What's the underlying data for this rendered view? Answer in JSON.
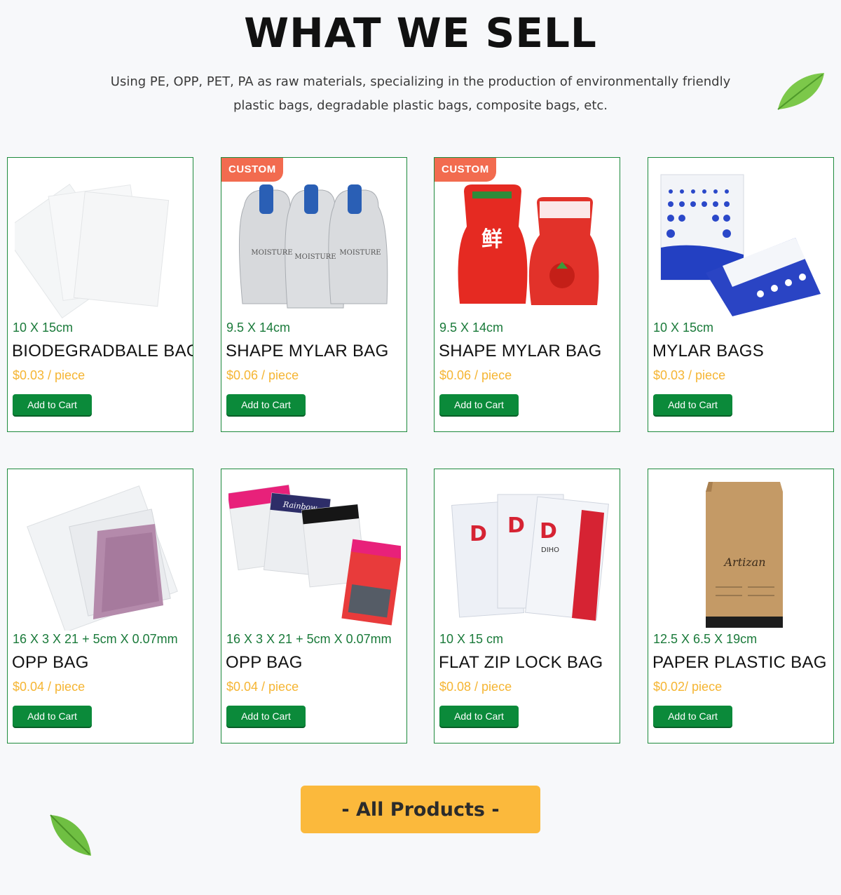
{
  "header": {
    "title": "WHAT WE SELL",
    "subtitle": "Using PE, OPP, PET, PA as raw materials, specializing in the production of environmentally friendly plastic bags, degradable plastic bags, composite bags, etc."
  },
  "products": [
    {
      "badge": "",
      "size": "10 X 15cm",
      "name": "BIODEGRADBALE BAGS",
      "price": "$0.03 / piece",
      "cart_label": "Add to Cart",
      "image": "clear-flat-bags"
    },
    {
      "badge": "CUSTOM",
      "size": "9.5 X 14cm",
      "name": "SHAPE MYLAR BAG",
      "price": "$0.06 / piece",
      "cart_label": "Add to Cart",
      "image": "bottle-shaped-mask-pouches"
    },
    {
      "badge": "CUSTOM",
      "size": "9.5 X 14cm",
      "name": "SHAPE MYLAR BAG",
      "price": "$0.06 / piece",
      "cart_label": "Add to Cart",
      "image": "red-sauce-pouches"
    },
    {
      "badge": "",
      "size": "10 X 15cm",
      "name": "MYLAR BAGS",
      "price": "$0.03 / piece",
      "cart_label": "Add to Cart",
      "image": "blue-dot-standup-pouches"
    },
    {
      "badge": "",
      "size": "16 X 3 X 21 + 5cm X 0.07mm",
      "name": "OPP BAG",
      "price": "$0.04 / piece",
      "cart_label": "Add to Cart",
      "image": "clear-opp-bag-with-cloth"
    },
    {
      "badge": "",
      "size": "16 X 3 X 21 + 5cm X 0.07mm",
      "name": "OPP BAG",
      "price": "$0.04 / piece",
      "cart_label": "Add to Cart",
      "image": "header-card-opp-bags"
    },
    {
      "badge": "",
      "size": "10 X 15 cm",
      "name": "FLAT ZIP LOCK BAG",
      "price": "$0.08 / piece",
      "cart_label": "Add to Cart",
      "image": "diho-zip-lock-bags"
    },
    {
      "badge": "",
      "size": "12.5 X 6.5 X 19cm",
      "name": "PAPER PLASTIC BAG",
      "price": "$0.02/ piece",
      "cart_label": "Add to Cart",
      "image": "kraft-coffee-bag"
    }
  ],
  "all_products_label": "- All Products -",
  "colors": {
    "accent_green": "#0b8a3a",
    "price_gold": "#f5b533",
    "badge_red": "#f26b4f",
    "button_yellow": "#fbb93c"
  }
}
